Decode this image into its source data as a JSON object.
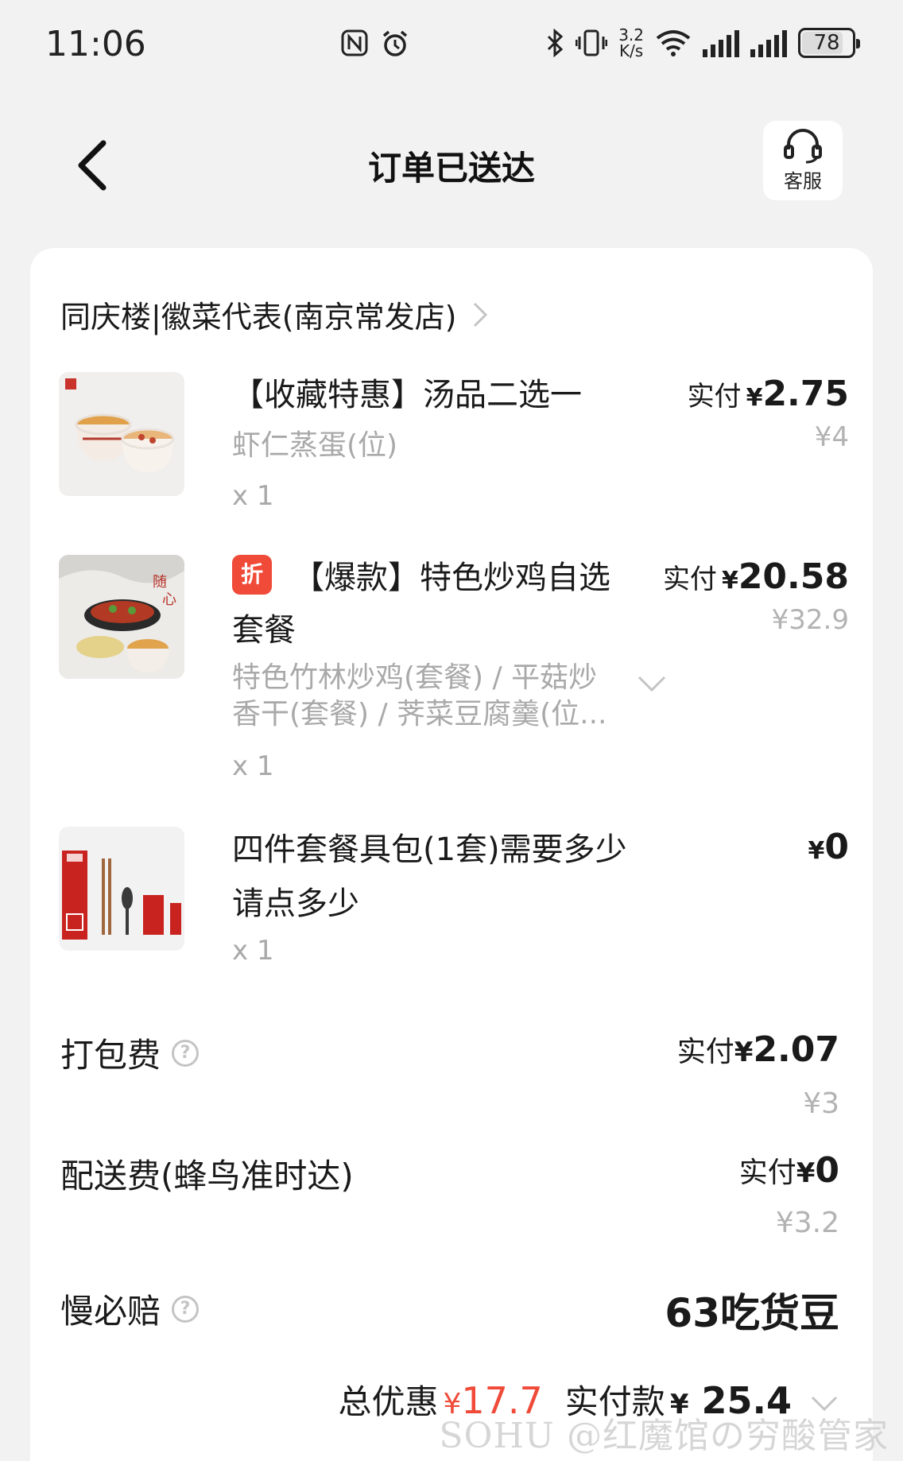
{
  "status_bar": {
    "time": "11:06",
    "nfc_icon": "nfc-icon",
    "alarm_icon": "alarm-icon",
    "bluetooth_icon": "bluetooth-icon",
    "vibrate_icon": "vibrate-icon",
    "net_speed_value": "3.2",
    "net_speed_unit": "K/s",
    "battery": "78"
  },
  "header": {
    "title": "订单已送达",
    "service_label": "客服"
  },
  "shop": {
    "name": "同庆楼|徽菜代表(南京常发店)"
  },
  "items": [
    {
      "title": "【收藏特惠】汤品二选一",
      "sub": "虾仁蒸蛋(位)",
      "qty": "x 1",
      "paid_label": "实付",
      "yen": "¥",
      "paid": "2.75",
      "orig": "¥4"
    },
    {
      "tag": "折",
      "title_line1": "【爆款】特色炒鸡自选",
      "title_line2": "套餐",
      "sub_line1": "特色竹林炒鸡(套餐) / 平菇炒",
      "sub_line2": "香干(套餐) / 荠菜豆腐羹(位...",
      "qty": "x 1",
      "paid_label": "实付",
      "yen": "¥",
      "paid": "20.58",
      "orig": "¥32.9"
    },
    {
      "title_line1": "四件套餐具包(1套)需要多少",
      "title_line2": "请点多少",
      "qty": "x 1",
      "yen": "¥",
      "paid": "0"
    }
  ],
  "fees": {
    "packing": {
      "label": "打包费",
      "paid_label": "实付",
      "yen": "¥",
      "paid": "2.07",
      "orig": "¥3"
    },
    "delivery": {
      "label": "配送费(蜂鸟准时达)",
      "paid_label": "实付",
      "yen": "¥",
      "paid": "0",
      "orig": "¥3.2"
    },
    "late": {
      "label": "慢必赔",
      "value": "63吃货豆"
    }
  },
  "total": {
    "discount_label": "总优惠",
    "yen": "¥",
    "discount": "17.7",
    "paid_label": "实付款",
    "paid": "25.4"
  },
  "watermark": "SOHU @红魔馆の穷酸管家",
  "colors": {
    "accent_red": "#f04a38",
    "card_bg": "#ffffff",
    "page_bg": "#f2f2f2",
    "muted_text": "#a9a9a9"
  }
}
